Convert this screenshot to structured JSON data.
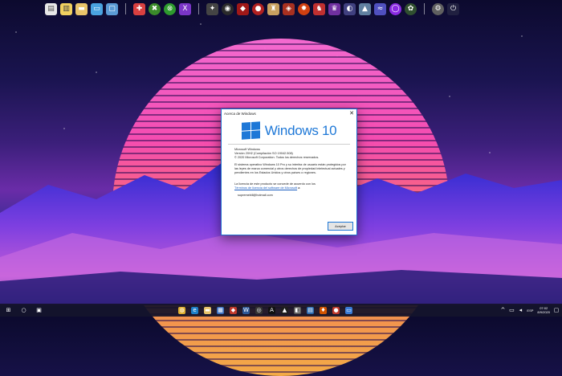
{
  "dialog": {
    "title": "Acerca de Windows",
    "close_glyph": "✕",
    "brand": "Windows 10",
    "product": "Microsoft Windows",
    "version": "Versión 20H2 (Compilación SO 19042.508)",
    "copyright": "© 2020 Microsoft Corporation. Todos los derechos reservados.",
    "description": "El sistema operativo Windows 10 Pro y su interfaz de usuario están protegidos por las leyes de marca comercial y otros derechos de propiedad intelectual actuales y pendientes en los Estados Unidos y otros países o regiones.",
    "license_intro": "La licencia de este producto se concede de acuerdo con los",
    "license_link": "Términos de licencia del software de Microsoft",
    "license_suffix": " a:",
    "licensee": "supremebill@hotmail.com",
    "ok_label": "Aceptar",
    "accent": "#1e78d7"
  },
  "taskbar": {
    "lang": "ESP",
    "time": "07:02",
    "date": "8/9/2020"
  },
  "dock_icons": [
    "file-icon",
    "notepad-icon",
    "folder-icon",
    "laptop-icon",
    "screen-icon",
    "sep",
    "jigsaw-icon",
    "xbox-green-icon",
    "xbox-icon",
    "x1-icon",
    "sep",
    "game-icon-1",
    "game-icon-2",
    "game-icon-3",
    "game-icon-4",
    "game-icon-5",
    "game-icon-6",
    "game-icon-7",
    "game-icon-8",
    "game-icon-9",
    "game-icon-10",
    "game-icon-11",
    "game-icon-12",
    "game-icon-13",
    "sep",
    "settings-icon",
    "power-icon"
  ]
}
